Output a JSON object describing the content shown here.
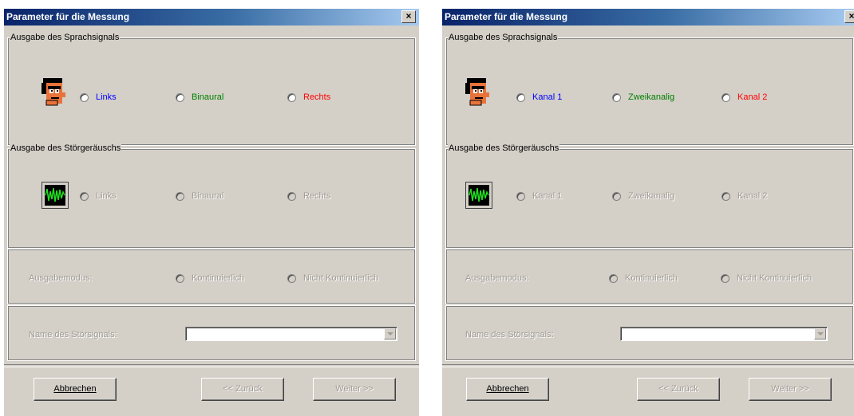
{
  "colors": {
    "blue": "#0000ff",
    "green": "#008000",
    "red": "#ff0000",
    "disabled": "#a09c94"
  },
  "dialogs": [
    {
      "title": "Parameter für die Messung",
      "close_label": "×",
      "speech_group": {
        "legend": "Ausgabe des Sprachsignals",
        "icon": "speaker-face-icon",
        "options": [
          "Links",
          "Binaural",
          "Rechts"
        ]
      },
      "noise_group": {
        "legend": "Ausgabe des Störgeräuschs",
        "icon": "noise-waveform-icon",
        "options": [
          "Links",
          "Binaural",
          "Rechts"
        ]
      },
      "mode": {
        "label": "Ausgabemodus:",
        "options": [
          "Kontinuierlich",
          "Nicht Kontinuierlich"
        ]
      },
      "noise_name": {
        "label": "Name des Störsignals:",
        "value": ""
      },
      "buttons": {
        "cancel": "Abbrechen",
        "back": "<< Zurück",
        "next": "Weiter >>"
      }
    },
    {
      "title": "Parameter für die Messung",
      "close_label": "×",
      "speech_group": {
        "legend": "Ausgabe des Sprachsignals",
        "icon": "speaker-face-icon",
        "options": [
          "Kanal 1",
          "Zweikanalig",
          "Kanal 2"
        ]
      },
      "noise_group": {
        "legend": "Ausgabe des Störgeräuschs",
        "icon": "noise-waveform-icon",
        "options": [
          "Kanal 1",
          "Zweikanalig",
          "Kanal 2"
        ]
      },
      "mode": {
        "label": "Ausgabemodus:",
        "options": [
          "Kontinuierlich",
          "Nicht Kontinuierlich"
        ]
      },
      "noise_name": {
        "label": "Name des Störsignals:",
        "value": ""
      },
      "buttons": {
        "cancel": "Abbrechen",
        "back": "<< Zurück",
        "next": "Weiter >>"
      }
    }
  ]
}
